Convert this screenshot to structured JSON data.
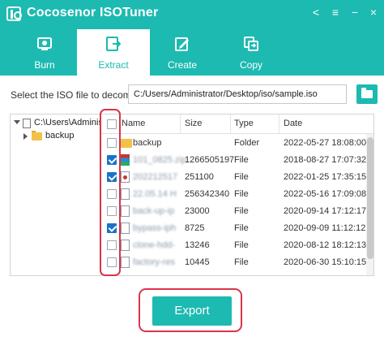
{
  "app": {
    "title": "Cocosenor ISOTuner"
  },
  "window_controls": {
    "share": "<",
    "menu": "≡",
    "minimize": "−",
    "close": "×"
  },
  "tabs": [
    {
      "label": "Burn",
      "icon": "burn-icon"
    },
    {
      "label": "Extract",
      "icon": "extract-icon",
      "active": true
    },
    {
      "label": "Create",
      "icon": "create-icon"
    },
    {
      "label": "Copy",
      "icon": "copy-icon"
    }
  ],
  "path": {
    "label": "Select the ISO file to decompress",
    "value": "C:/Users/Administrator/Desktop/iso/sample.iso"
  },
  "tree": {
    "items": [
      {
        "label": "C:\\Users\\Administrator",
        "expanded": true
      },
      {
        "label": "backup",
        "expanded": false
      }
    ]
  },
  "table": {
    "headers": {
      "name": "Name",
      "size": "Size",
      "type": "Type",
      "date": "Date"
    },
    "rows": [
      {
        "checked": false,
        "icon": "folder",
        "name": "backup",
        "size": "",
        "type": "Folder",
        "date": "2022-05-27 18:08:00",
        "blurred": false
      },
      {
        "checked": true,
        "icon": "zip",
        "name": "101_0825.zip",
        "size": "1266505197",
        "type": "File",
        "date": "2018-08-27 17:07:32",
        "blurred": true
      },
      {
        "checked": true,
        "icon": "img",
        "name": "202212517",
        "size": "251100",
        "type": "File",
        "date": "2022-01-25 17:35:15",
        "blurred": true
      },
      {
        "checked": false,
        "icon": "file",
        "name": "22.05.14 H",
        "size": "256342340",
        "type": "File",
        "date": "2022-05-16 17:09:08",
        "blurred": true
      },
      {
        "checked": false,
        "icon": "file",
        "name": "back-up-ip",
        "size": "23000",
        "type": "File",
        "date": "2020-09-14 17:12:17",
        "blurred": true
      },
      {
        "checked": true,
        "icon": "file",
        "name": "bypass-iph",
        "size": "8725",
        "type": "File",
        "date": "2020-09-09 11:12:12",
        "blurred": true
      },
      {
        "checked": false,
        "icon": "file",
        "name": "clone-hdd-",
        "size": "13246",
        "type": "File",
        "date": "2020-08-12 18:12:13",
        "blurred": true
      },
      {
        "checked": false,
        "icon": "file",
        "name": "factory-res",
        "size": "10445",
        "type": "File",
        "date": "2020-06-30 15:10:15",
        "blurred": true
      }
    ]
  },
  "export": {
    "label": "Export"
  },
  "colors": {
    "accent": "#1dbab1",
    "highlight": "#d9354a",
    "checkbox": "#1a73c8"
  }
}
